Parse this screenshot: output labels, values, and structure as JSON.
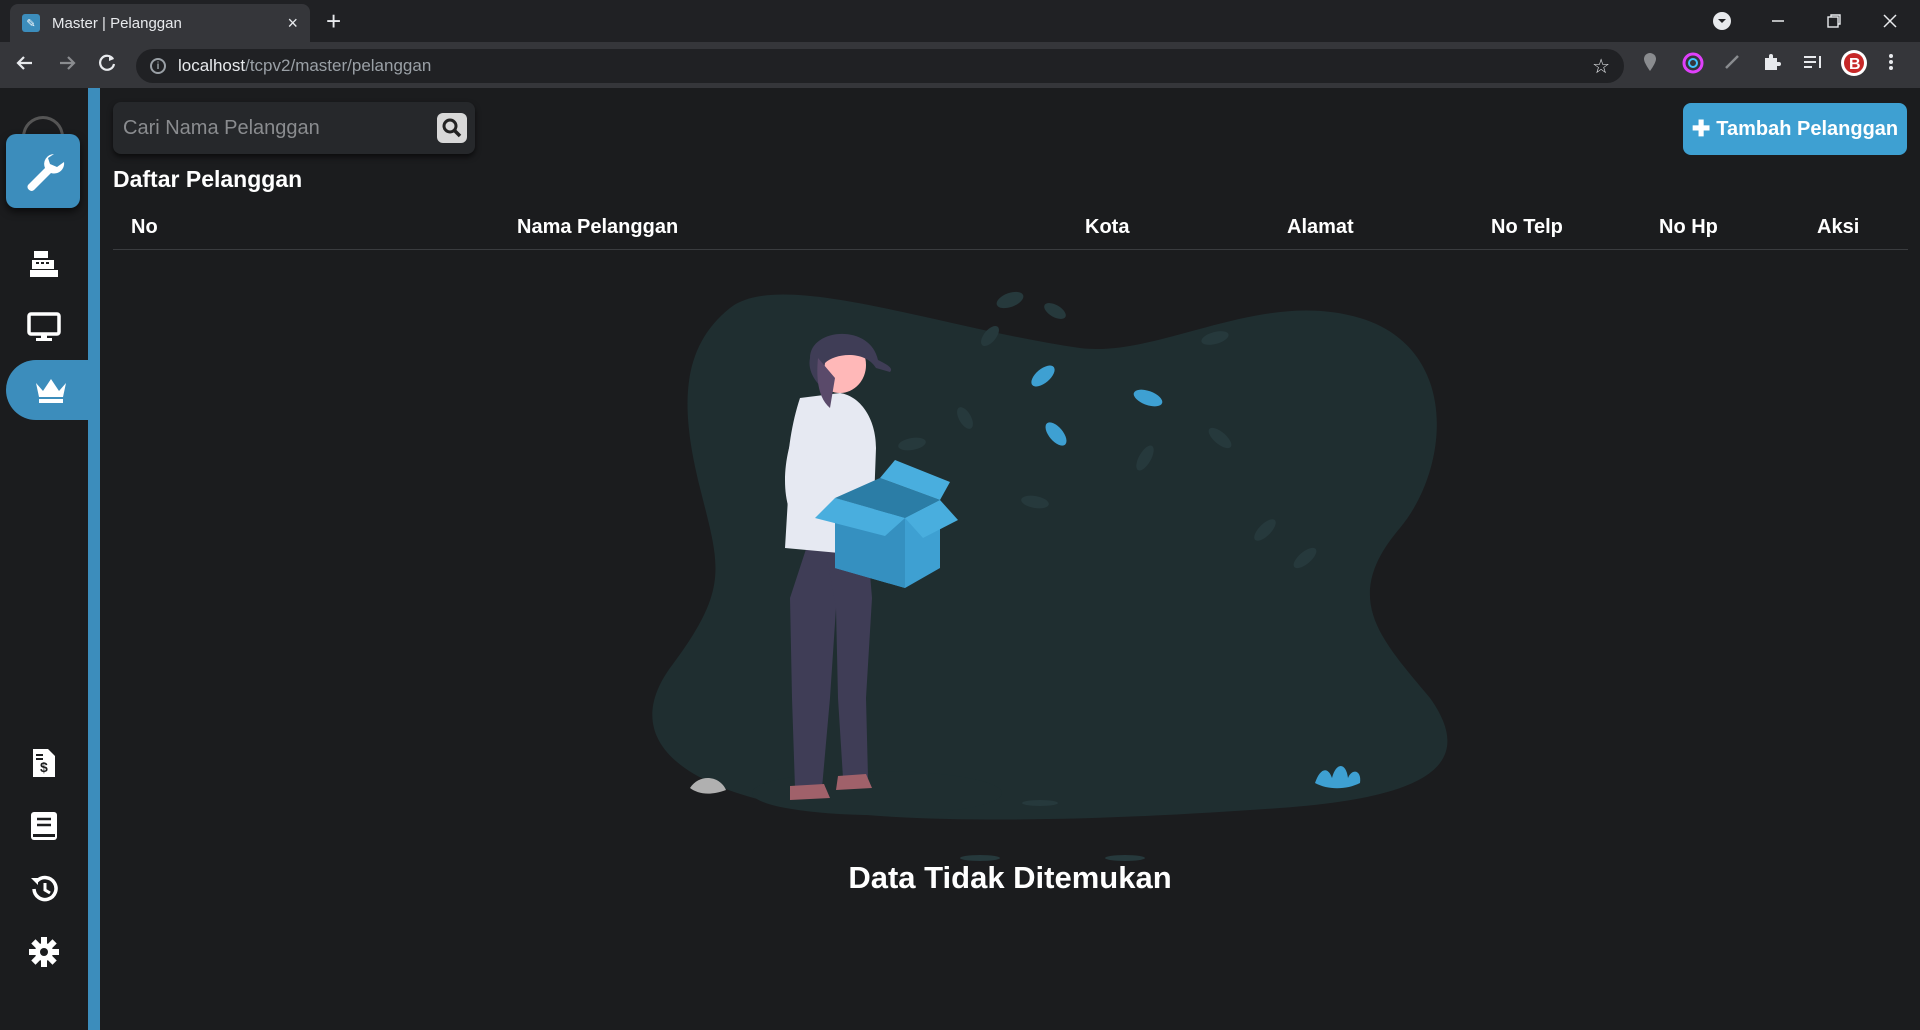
{
  "browser": {
    "tab_title": "Master | Pelanggan",
    "tab_close": "×",
    "new_tab": "+",
    "url_host": "localhost",
    "url_path": "/tcpv2/master/pelanggan"
  },
  "search": {
    "placeholder": "Cari Nama Pelanggan"
  },
  "actions": {
    "add_label": "Tambah Pelanggan"
  },
  "page": {
    "title": "Daftar Pelanggan",
    "empty_message": "Data Tidak Ditemukan"
  },
  "table": {
    "columns": [
      "No",
      "Nama Pelanggan",
      "Kota",
      "Alamat",
      "No Telp",
      "No Hp",
      "Aksi"
    ],
    "rows": []
  },
  "sidebar": {
    "items": [
      {
        "icon": "cash-register-icon"
      },
      {
        "icon": "desktop-icon"
      },
      {
        "icon": "crown-icon",
        "active": true
      },
      {
        "icon": "invoice-icon"
      },
      {
        "icon": "book-icon"
      },
      {
        "icon": "history-icon"
      },
      {
        "icon": "gear-icon"
      }
    ]
  },
  "colors": {
    "accent": "#3c8dbc",
    "button": "#3ea0d2",
    "background": "#1b1c1e"
  }
}
